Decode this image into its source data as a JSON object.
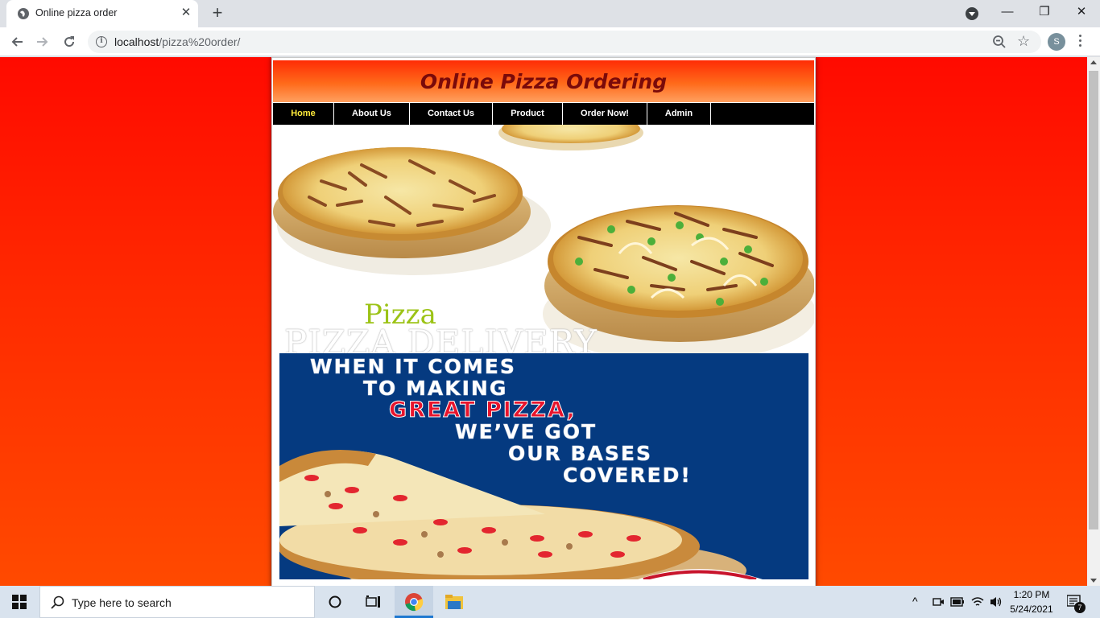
{
  "browser": {
    "tab_title": "Online pizza order",
    "tab_close_glyph": "✕",
    "new_tab_glyph": "+",
    "url_host": "localhost",
    "url_path": "/pizza%20order/",
    "profile_initial": "S",
    "window_controls": {
      "minimize": "—",
      "maximize": "❐",
      "close": "✕"
    }
  },
  "site": {
    "title": "Online Pizza Ordering",
    "nav": [
      {
        "label": "Home",
        "active": true
      },
      {
        "label": "About Us",
        "active": false
      },
      {
        "label": "Contact Us",
        "active": false
      },
      {
        "label": "Product",
        "active": false
      },
      {
        "label": "Order Now!",
        "active": false
      },
      {
        "label": "Admin",
        "active": false
      }
    ],
    "hero": {
      "pizza_word": "Pizza",
      "delivery_word": "PIZZA DELIVERY"
    },
    "banner": {
      "lines": [
        "WHEN IT COMES",
        "TO MAKING",
        "GREAT PIZZA,",
        "WE’VE GOT",
        "OUR BASES",
        "COVERED!"
      ]
    },
    "colors": {
      "background": "#ff2a00",
      "header_text": "#7a0a0a",
      "nav_active": "#ffeb3b",
      "banner_bg": "#053a80",
      "banner_accent": "#e8142c"
    }
  },
  "taskbar": {
    "search_placeholder": "Type here to search",
    "time": "1:20 PM",
    "date": "5/24/2021",
    "notification_count": "7"
  }
}
